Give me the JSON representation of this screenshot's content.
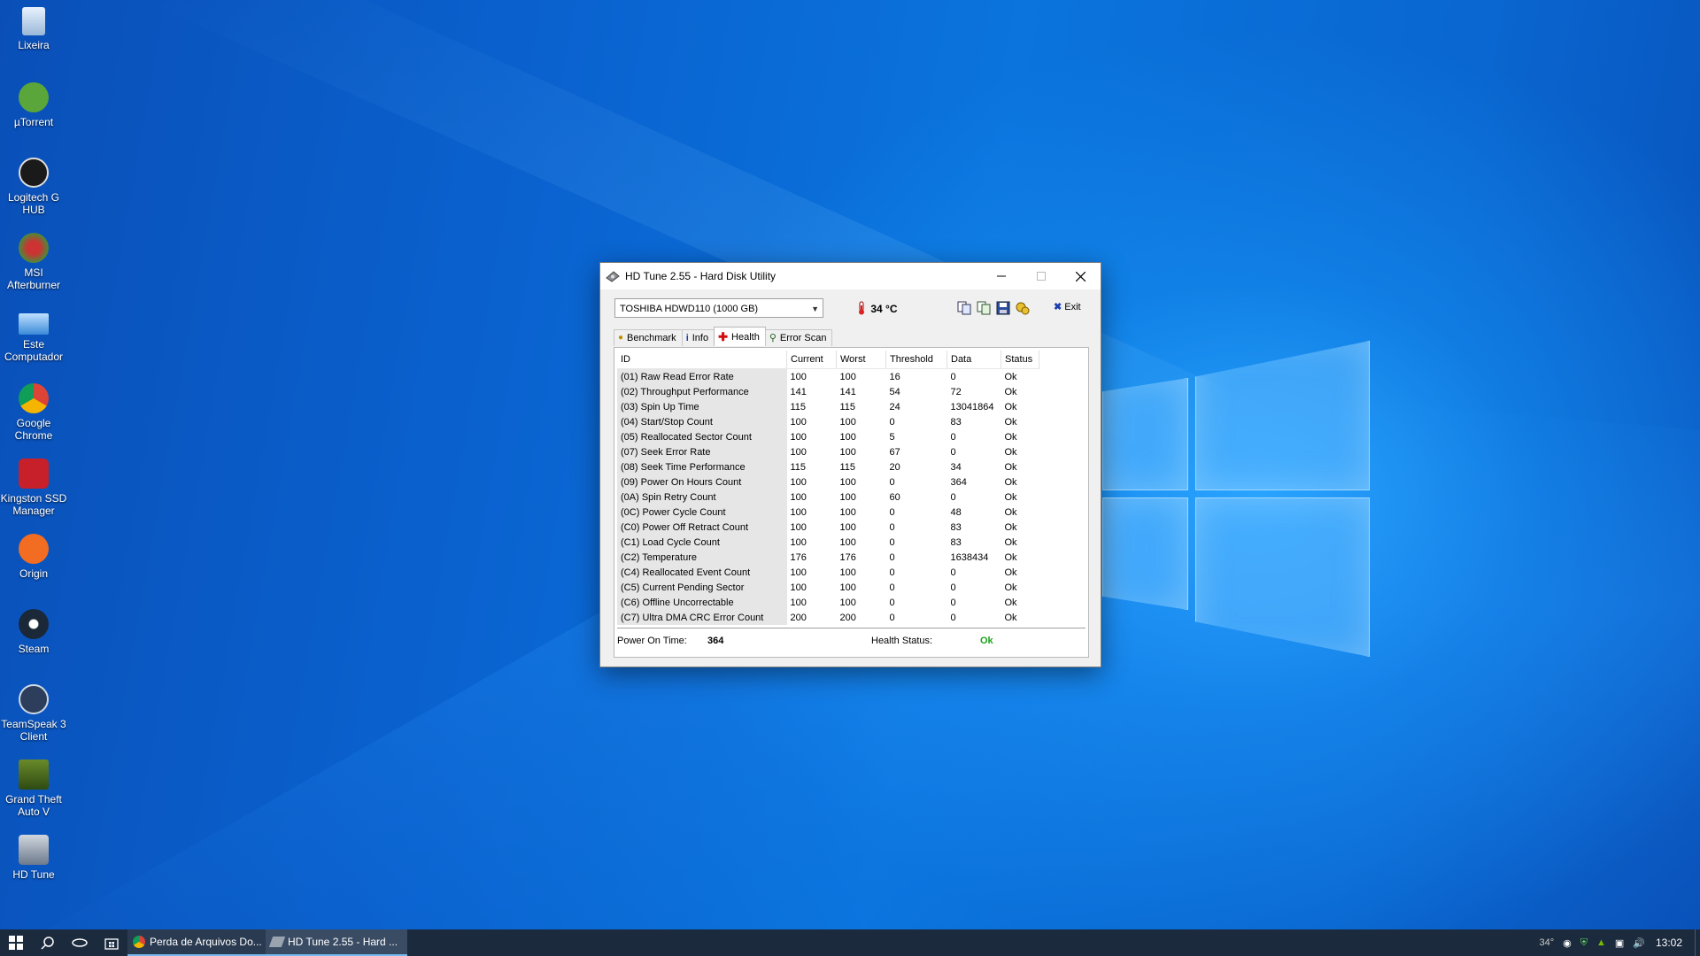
{
  "desktop": {
    "icons": [
      {
        "label": "Lixeira"
      },
      {
        "label": "µTorrent"
      },
      {
        "label": "Logitech G HUB"
      },
      {
        "label": "MSI Afterburner"
      },
      {
        "label": "Este Computador"
      },
      {
        "label": "Google Chrome"
      },
      {
        "label": "Kingston SSD Manager"
      },
      {
        "label": "Origin"
      },
      {
        "label": "Steam"
      },
      {
        "label": "TeamSpeak 3 Client"
      },
      {
        "label": "Grand Theft Auto V"
      },
      {
        "label": "HD Tune"
      }
    ]
  },
  "window": {
    "title": "HD Tune 2.55 - Hard Disk Utility",
    "drive_select": "TOSHIBA HDWD110 (1000 GB)",
    "temperature": "34 °C",
    "exit_label": "Exit",
    "tabs": [
      {
        "label": "Benchmark"
      },
      {
        "label": "Info"
      },
      {
        "label": "Health"
      },
      {
        "label": "Error Scan"
      }
    ],
    "columns": [
      "ID",
      "Current",
      "Worst",
      "Threshold",
      "Data",
      "Status"
    ],
    "rows": [
      {
        "id": "(01) Raw Read Error Rate",
        "current": "100",
        "worst": "100",
        "threshold": "16",
        "data": "0",
        "status": "Ok"
      },
      {
        "id": "(02) Throughput Performance",
        "current": "141",
        "worst": "141",
        "threshold": "54",
        "data": "72",
        "status": "Ok"
      },
      {
        "id": "(03) Spin Up Time",
        "current": "115",
        "worst": "115",
        "threshold": "24",
        "data": "13041864",
        "status": "Ok"
      },
      {
        "id": "(04) Start/Stop Count",
        "current": "100",
        "worst": "100",
        "threshold": "0",
        "data": "83",
        "status": "Ok"
      },
      {
        "id": "(05) Reallocated Sector Count",
        "current": "100",
        "worst": "100",
        "threshold": "5",
        "data": "0",
        "status": "Ok"
      },
      {
        "id": "(07) Seek Error Rate",
        "current": "100",
        "worst": "100",
        "threshold": "67",
        "data": "0",
        "status": "Ok"
      },
      {
        "id": "(08) Seek Time Performance",
        "current": "115",
        "worst": "115",
        "threshold": "20",
        "data": "34",
        "status": "Ok"
      },
      {
        "id": "(09) Power On Hours Count",
        "current": "100",
        "worst": "100",
        "threshold": "0",
        "data": "364",
        "status": "Ok"
      },
      {
        "id": "(0A) Spin Retry Count",
        "current": "100",
        "worst": "100",
        "threshold": "60",
        "data": "0",
        "status": "Ok"
      },
      {
        "id": "(0C) Power Cycle Count",
        "current": "100",
        "worst": "100",
        "threshold": "0",
        "data": "48",
        "status": "Ok"
      },
      {
        "id": "(C0) Power Off Retract Count",
        "current": "100",
        "worst": "100",
        "threshold": "0",
        "data": "83",
        "status": "Ok"
      },
      {
        "id": "(C1) Load Cycle Count",
        "current": "100",
        "worst": "100",
        "threshold": "0",
        "data": "83",
        "status": "Ok"
      },
      {
        "id": "(C2) Temperature",
        "current": "176",
        "worst": "176",
        "threshold": "0",
        "data": "1638434",
        "status": "Ok"
      },
      {
        "id": "(C4) Reallocated Event Count",
        "current": "100",
        "worst": "100",
        "threshold": "0",
        "data": "0",
        "status": "Ok"
      },
      {
        "id": "(C5) Current Pending Sector",
        "current": "100",
        "worst": "100",
        "threshold": "0",
        "data": "0",
        "status": "Ok"
      },
      {
        "id": "(C6) Offline Uncorrectable",
        "current": "100",
        "worst": "100",
        "threshold": "0",
        "data": "0",
        "status": "Ok"
      },
      {
        "id": "(C7) Ultra DMA CRC Error Count",
        "current": "200",
        "worst": "200",
        "threshold": "0",
        "data": "0",
        "status": "Ok"
      }
    ],
    "power_on_label": "Power On Time:",
    "power_on_value": "364",
    "health_label": "Health Status:",
    "health_value": "Ok",
    "health_color": "#1aa31a"
  },
  "taskbar": {
    "apps": [
      {
        "label": "Perda de Arquivos Do..."
      },
      {
        "label": "HD Tune 2.55 - Hard ..."
      }
    ],
    "tray_temp": "34°",
    "clock": "13:02"
  }
}
